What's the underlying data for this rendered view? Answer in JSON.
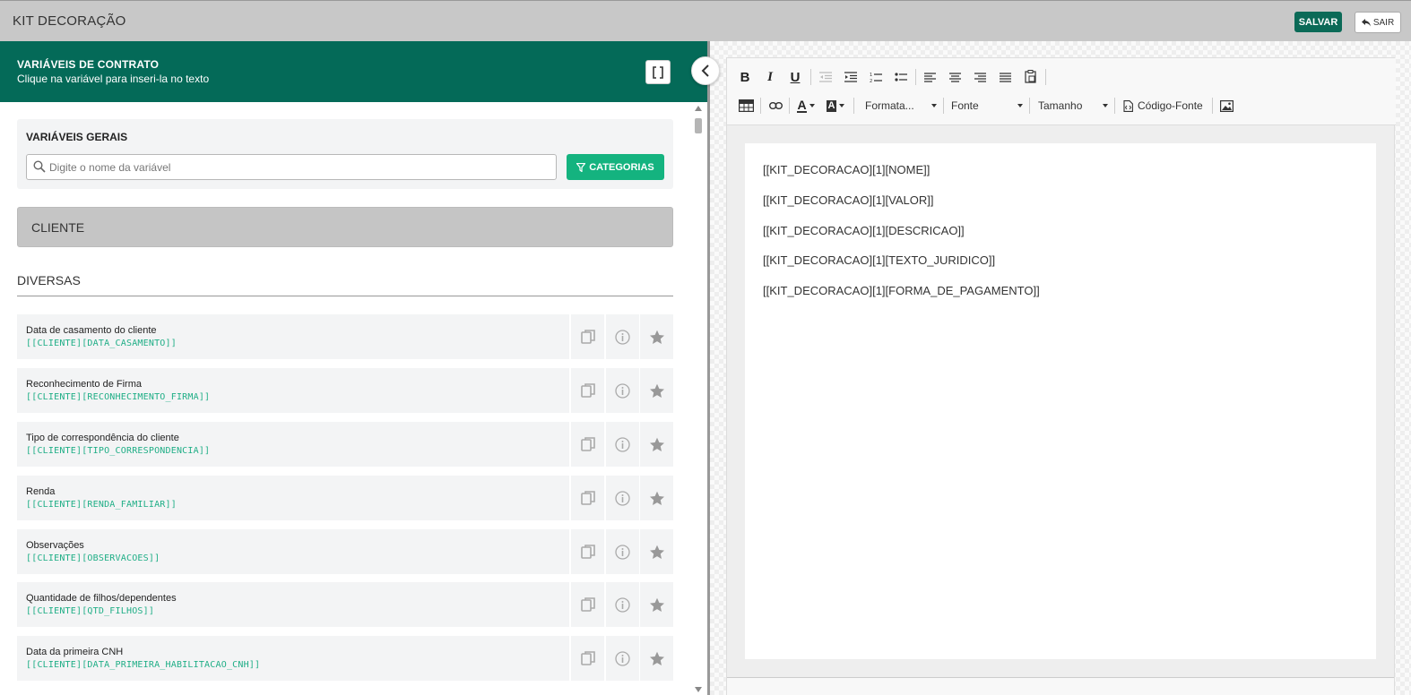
{
  "app": {
    "title": "KIT DECORAÇÃO",
    "save_label": "SALVAR",
    "exit_label": "SAIR"
  },
  "left_panel": {
    "header_title": "VARIÁVEIS DE CONTRATO",
    "header_subtitle": "Clique na variável para inseri-la no texto",
    "general_label": "VARIÁVEIS GERAIS",
    "search_placeholder": "Digite o nome da variável",
    "categories_label": "CATEGORIAS",
    "category_group": "CLIENTE",
    "section_title": "DIVERSAS",
    "variables": [
      {
        "name": "Data de casamento do cliente",
        "code": "[[CLIENTE][DATA_CASAMENTO]]"
      },
      {
        "name": "Reconhecimento de Firma",
        "code": "[[CLIENTE][RECONHECIMENTO_FIRMA]]"
      },
      {
        "name": "Tipo de correspondência do cliente",
        "code": "[[CLIENTE][TIPO_CORRESPONDENCIA]]"
      },
      {
        "name": "Renda",
        "code": "[[CLIENTE][RENDA_FAMILIAR]]"
      },
      {
        "name": "Observações",
        "code": "[[CLIENTE][OBSERVACOES]]"
      },
      {
        "name": "Quantidade de filhos/dependentes",
        "code": "[[CLIENTE][QTD_FILHOS]]"
      },
      {
        "name": "Data da primeira CNH",
        "code": "[[CLIENTE][DATA_PRIMEIRA_HABILITACAO_CNH]]"
      }
    ]
  },
  "editor": {
    "format_label": "Formata...",
    "font_label": "Fonte",
    "size_label": "Tamanho",
    "source_label": "Código-Fonte",
    "lines": [
      "[[KIT_DECORACAO][1][NOME]]",
      "[[KIT_DECORACAO][1][VALOR]]",
      "[[KIT_DECORACAO][1][DESCRICAO]]",
      "[[KIT_DECORACAO][1][TEXTO_JURIDICO]]",
      "[[KIT_DECORACAO][1][FORMA_DE_PAGAMENTO]]"
    ]
  },
  "colors": {
    "brand": "#046a58",
    "accent": "#14b37f",
    "variable_code": "#1fae86"
  }
}
